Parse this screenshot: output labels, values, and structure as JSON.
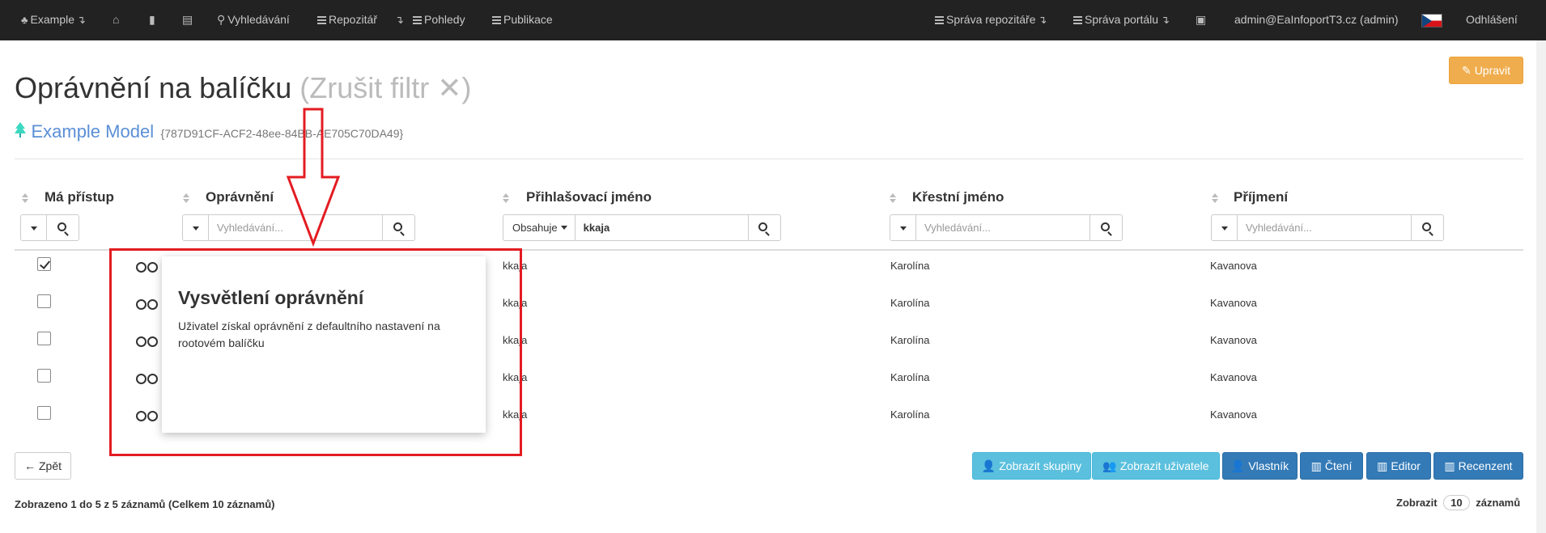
{
  "navbar": {
    "brand_label": "Example",
    "search_label": "Vyhledávání",
    "repository_label": "Repozitář",
    "views_label": "Pohledy",
    "publications_label": "Publikace",
    "repo_admin_label": "Správa repozitáře",
    "portal_admin_label": "Správa portálu",
    "user_label": "admin@EaInfoportT3.cz (admin)",
    "logout_label": "Odhlášení",
    "caret_glyph": "↴"
  },
  "header": {
    "edit_button": "Upravit",
    "title": "Oprávnění na balíčku",
    "clear_filter": "(Zrušit filtr",
    "clear_filter_close": ")",
    "model_name": "Example Model",
    "model_guid": "{787D91CF-ACF2-48ee-84BB-AE705C70DA49}"
  },
  "table": {
    "columns": {
      "has_access": "Má přístup",
      "permission": "Oprávnění",
      "login": "Přihlašovací jméno",
      "first_name": "Křestní jméno",
      "last_name": "Příjmení"
    },
    "filters": {
      "search_placeholder": "Vyhledávání...",
      "login_mode": "Obsahuje",
      "login_value": "kkaja"
    },
    "rows": [
      {
        "has_access": true,
        "login": "kkaja",
        "first_name": "Karolína",
        "last_name": "Kavanova"
      },
      {
        "has_access": false,
        "login": "kkaja",
        "first_name": "Karolína",
        "last_name": "Kavanova"
      },
      {
        "has_access": false,
        "login": "kkaja",
        "first_name": "Karolína",
        "last_name": "Kavanova"
      },
      {
        "has_access": false,
        "login": "kkaja",
        "first_name": "Karolína",
        "last_name": "Kavanova"
      },
      {
        "has_access": false,
        "login": "kkaja",
        "first_name": "Karolína",
        "last_name": "Kavanova"
      }
    ]
  },
  "popover": {
    "title": "Vysvětlení oprávnění",
    "body": "Uživatel získal oprávnění z defaultního nastavení na rootovém balíčku"
  },
  "footer": {
    "back_button": "Zpět",
    "show_groups": "Zobrazit skupiny",
    "show_users": "Zobrazit uživatele",
    "owner": "Vlastník",
    "read": "Čtení",
    "editor": "Editor",
    "reviewer": "Recenzent",
    "status": "Zobrazeno 1 do 5 z 5 záznamů (Celkem 10 záznamů)",
    "page_size_prefix": "Zobrazit",
    "page_size_value": "10",
    "page_size_suffix": "záznamů"
  },
  "colors": {
    "navbar_bg": "#222222",
    "edit_button": "#f0ad4e",
    "info_button": "#5bc0de",
    "primary_button": "#337ab7",
    "annotation": "#e31c22",
    "model_link": "#5b8fd6"
  },
  "icons": {
    "brand": "tree-icon",
    "nav_home": "home-icon",
    "nav_bookmark": "bookmark-icon",
    "nav_book": "book-icon",
    "nav_search": "search-icon",
    "permission": "glasses-icon"
  }
}
